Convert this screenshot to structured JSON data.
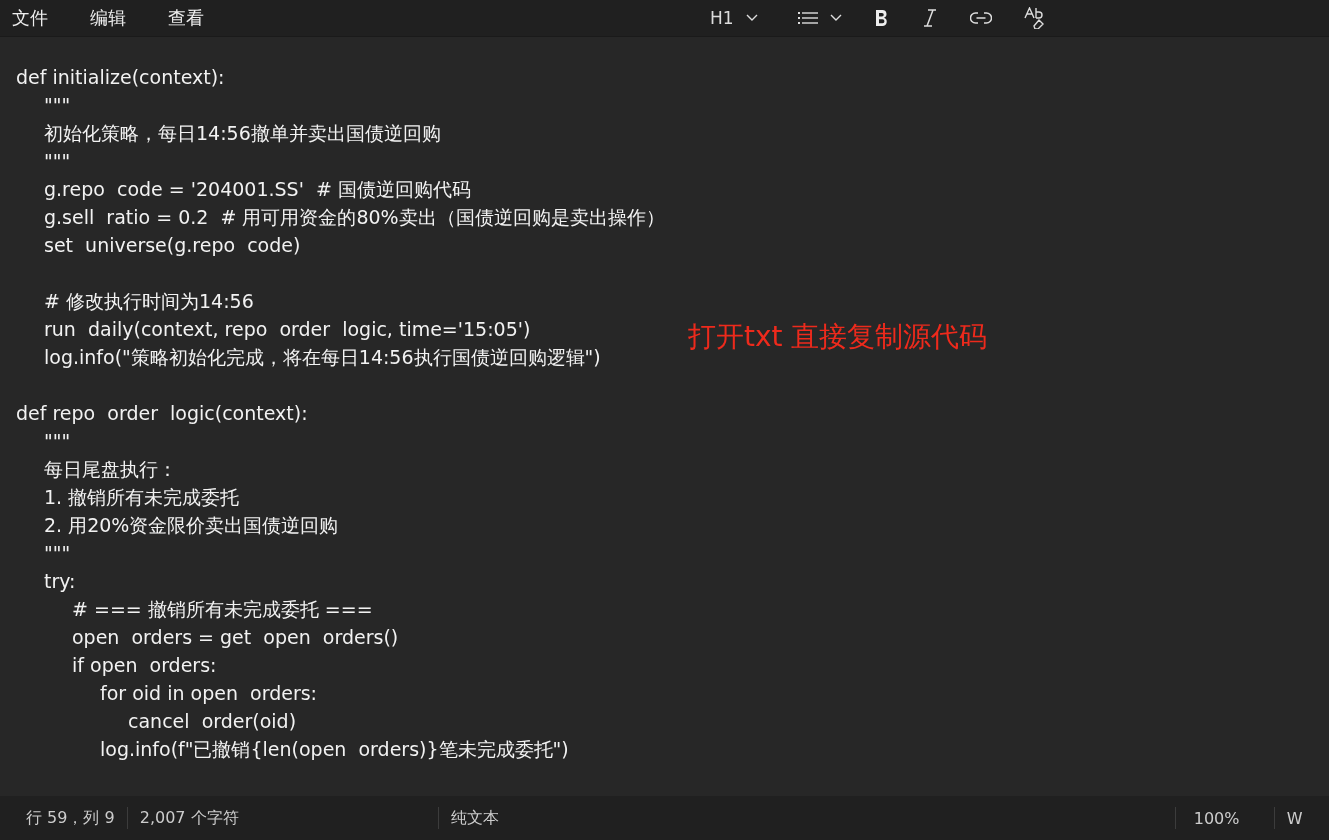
{
  "menu": [
    "文件",
    "编辑",
    "查看"
  ],
  "toolbar": {
    "heading": "H1"
  },
  "code": [
    {
      "text": "def initialize(context):",
      "children": [
        {
          "text": "\"\"\""
        },
        {
          "text": "初始化策略，每日14:56撤单并卖出国债逆回购"
        },
        {
          "text": "\"\"\""
        },
        {
          "text": "g.repo  code = '204001.SS'  # 国债逆回购代码"
        },
        {
          "text": "g.sell  ratio = 0.2  # 用可用资金的80%卖出（国债逆回购是卖出操作）"
        },
        {
          "text": "set  universe(g.repo  code)"
        },
        {
          "kind": "blank"
        },
        {
          "text": "# 修改执行时间为14:56"
        },
        {
          "text": "run  daily(context, repo  order  logic, time='15:05')"
        },
        {
          "text": "log.info(\"策略初始化完成，将在每日14:56执行国债逆回购逻辑\")"
        }
      ]
    },
    {
      "kind": "blank"
    },
    {
      "text": "def repo  order  logic(context):",
      "children": [
        {
          "text": "\"\"\""
        },
        {
          "text": "每日尾盘执行："
        },
        {
          "text": "1. 撤销所有未完成委托"
        },
        {
          "text": "2. 用20%资金限价卖出国债逆回购"
        },
        {
          "text": "\"\"\""
        },
        {
          "text": "try:",
          "children": [
            {
              "text": "# === 撤销所有未完成委托 ==="
            },
            {
              "text": "open  orders = get  open  orders()"
            },
            {
              "text": "if open  orders:",
              "children": [
                {
                  "text": "for oid in open  orders:",
                  "children": [
                    {
                      "text": "cancel  order(oid)"
                    }
                  ]
                },
                {
                  "text": "log.info(f\"已撤销{len(open  orders)}笔未完成委托\")"
                }
              ]
            }
          ]
        }
      ]
    }
  ],
  "annotation": "打开txt 直接复制源代码",
  "status_bar": {
    "position": "行 59，列 9",
    "characters": "2,007 个字符",
    "format": "纯文本",
    "zoom": "100%",
    "column_5": "W"
  }
}
